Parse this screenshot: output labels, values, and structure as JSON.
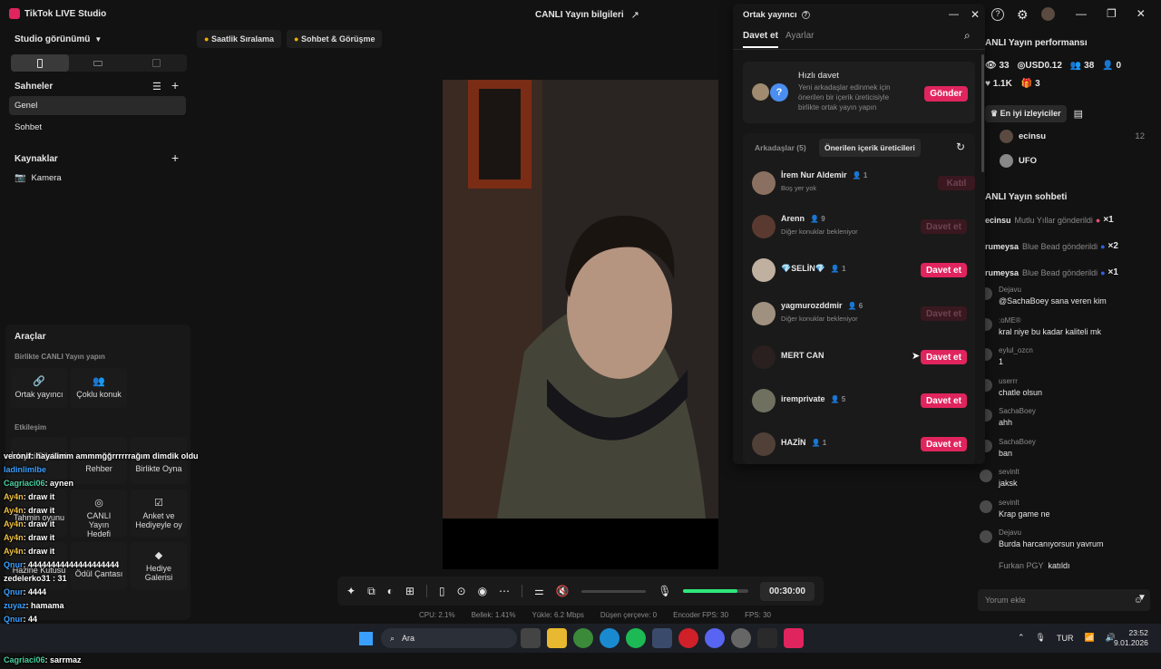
{
  "app": {
    "title": "TikTok LIVE Studio",
    "center_title": "CANLI Yayın bilgileri"
  },
  "left": {
    "studio_view": "Studio görünümü",
    "scenes_title": "Sahneler",
    "scenes": [
      "Genel",
      "Sohbet"
    ],
    "sources_title": "Kaynaklar",
    "sources": [
      "Kamera"
    ],
    "tools_title": "Araçlar",
    "collab_title": "Birlikte CANLI Yayın yapın",
    "collab_tools": [
      "Ortak yayıncı",
      "Çoklu konuk"
    ],
    "interaction_title": "Etkileşim",
    "interaction_tools": [
      "İzleyici Dilekleri",
      "Rehber",
      "Birlikte Oyna",
      "Tahmin oyunu",
      "CANLI Yayın Hedefi",
      "Anket ve Hediyeyle oy",
      "Hazine Kutusu",
      "Ödül Çantası",
      "Hediye Galerisi"
    ]
  },
  "chips": [
    "Saatlik Sıralama",
    "Sohbet & Görüşme"
  ],
  "overlay_chat": [
    {
      "user": "veronif",
      "text": ": hayalimm ammmğğrrrrrrağım dimdik oldu",
      "color": "#ffffff"
    },
    {
      "user": "ladinlimlbe",
      "text": "",
      "color": "#3aa0ff"
    },
    {
      "user": "Cagriaci06",
      "text": ": aynen",
      "color": "#4ad0a0"
    },
    {
      "user": "Ay4n",
      "text": ": draw it",
      "color": "#f0c040"
    },
    {
      "user": "Ay4n",
      "text": ": draw it",
      "color": "#f0c040"
    },
    {
      "user": "Ay4n",
      "text": ": draw it",
      "color": "#f0c040"
    },
    {
      "user": "Ay4n",
      "text": ": draw it",
      "color": "#f0c040"
    },
    {
      "user": "Ay4n",
      "text": ": draw it",
      "color": "#f0c040"
    },
    {
      "user": "Qnur",
      "text": ": 44444444444444444444",
      "color": "#3aa0ff"
    },
    {
      "user": "zedelerko",
      "text": "31 : 31",
      "color": "#ffffff"
    },
    {
      "user": "Qnur",
      "text": ": 4444",
      "color": "#3aa0ff"
    },
    {
      "user": "zuyaz",
      "text": ": hamama",
      "color": "#3aa0ff"
    },
    {
      "user": "Qnur",
      "text": ": 44",
      "color": "#3aa0ff"
    },
    {
      "user": "Qnur",
      "text": ": 4",
      "color": "#3aa0ff"
    },
    {
      "user": "Qnur",
      "text": ": 4",
      "color": "#3aa0ff"
    },
    {
      "user": "Cagriaci06",
      "text": ": sarrmaz",
      "color": "#4ad0a0"
    }
  ],
  "bottombar": {
    "time": "00:30:00"
  },
  "statusbar": {
    "cpu": "CPU: 2.1%",
    "memory": "Bellek: 1.41%",
    "upload": "Yükle: 6.2 Mbps",
    "dropped": "Düşen çerçeve: 0",
    "encoder": "Encoder FPS: 30",
    "fps": "FPS: 30"
  },
  "popup": {
    "title": "Ortak yayıncı",
    "tabs": [
      "Davet et",
      "Ayarlar"
    ],
    "quick_title": "Hızlı davet",
    "quick_desc": "Yeni arkadaşlar edinmek için önerilen bir içerik üreticisiyle birlikte ortak yayın yapın",
    "quick_button": "Gönder",
    "filter_tabs": [
      "Arkadaşlar (5)",
      "Önerilen içerik üreticileri"
    ],
    "users": [
      {
        "name": "İrem Nur Aldemir",
        "count": "1",
        "status": "Boş yer yok",
        "button": "Katıl",
        "active": false
      },
      {
        "name": "Arenn",
        "count": "9",
        "status": "Diğer konuklar bekleniyor",
        "button": "Davet et",
        "active": false
      },
      {
        "name": "💎SELİN💎",
        "count": "1",
        "status": "",
        "button": "Davet et",
        "active": true
      },
      {
        "name": "yagmurozddmir",
        "count": "6",
        "status": "Diğer konuklar bekleniyor",
        "button": "Davet et",
        "active": false
      },
      {
        "name": "MERT CAN",
        "count": "",
        "status": "",
        "button": "Davet et",
        "active": true
      },
      {
        "name": "iremprivate",
        "count": "5",
        "status": "",
        "button": "Davet et",
        "active": true
      },
      {
        "name": "HAZİN",
        "count": "1",
        "status": "",
        "button": "Davet et",
        "active": true
      }
    ]
  },
  "right": {
    "perf_title": "ANLI Yayın performansı",
    "stats": [
      "33",
      "USD0.12",
      "38",
      "0",
      "1.1K",
      "3"
    ],
    "top_viewers_label": "En iyi izleyiciler",
    "top_viewers": [
      {
        "name": "ecinsu",
        "score": "12"
      },
      {
        "name": "UFO",
        "score": ""
      }
    ],
    "chat_title": "ANLI Yayın sohbeti",
    "gifts": [
      {
        "user": "ecinsu",
        "text": "Mutlu Yıllar gönderildi",
        "count": "×1"
      },
      {
        "user": "rumeysa",
        "text": "Blue Bead gönderildi",
        "count": "×2"
      },
      {
        "user": "rumeysa",
        "text": "Blue Bead gönderildi",
        "count": "×1"
      }
    ],
    "messages": [
      {
        "user": "Dejavu",
        "text": "@SachaBoey sana veren kim"
      },
      {
        "user": ":oME®",
        "text": "kral niye bu kadar kaliteli mk"
      },
      {
        "user": "eylul_ozcn",
        "text": "1"
      },
      {
        "user": "userrr",
        "text": "chatle olsun"
      },
      {
        "user": "SachaBoey",
        "text": "ahh"
      },
      {
        "user": "SachaBoey",
        "text": "ban"
      },
      {
        "user": "sevinlt",
        "text": "jaksk"
      },
      {
        "user": "sevinlt",
        "text": "Krap game ne"
      },
      {
        "user": "Dejavu",
        "text": "Burda harcanıyorsun yavrum"
      }
    ],
    "join": {
      "user": "Furkan PGY",
      "text": "katıldı"
    },
    "comment_placeholder": "Yorum ekle"
  },
  "taskbar": {
    "search": "Ara",
    "lang": "TUR",
    "time": "23:52",
    "date": "9.01.2026"
  },
  "colors": {
    "accent": "#e0245e",
    "bg": "#121212",
    "panel": "#181818"
  }
}
